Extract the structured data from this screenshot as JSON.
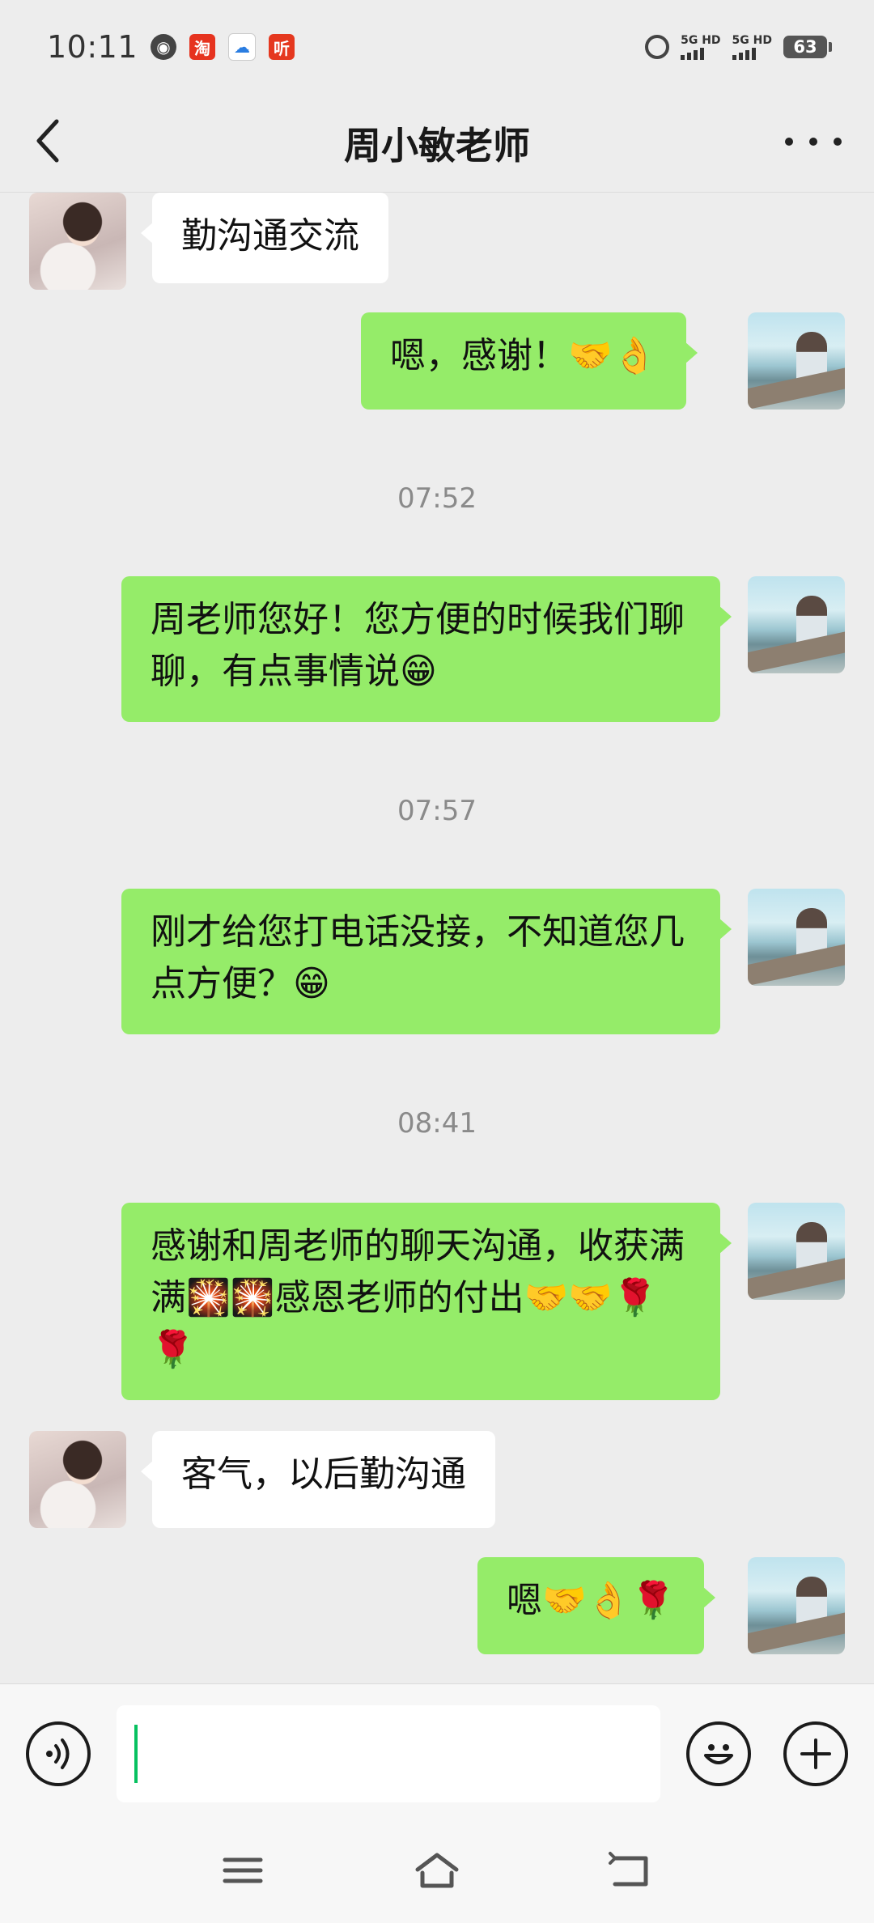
{
  "status_bar": {
    "time": "10:11",
    "network_1": "5G HD",
    "network_2": "5G HD",
    "battery": "63",
    "app_icons": [
      "globe-icon",
      "taobao-icon",
      "cloud-icon",
      "listen-icon"
    ]
  },
  "header": {
    "title": "周小敏老师",
    "back_icon": "chevron-left-icon",
    "more_icon": "more-dots-icon"
  },
  "messages": [
    {
      "side": "in",
      "text": "勤沟通交流"
    },
    {
      "side": "out",
      "text": "嗯，感谢！🤝👌"
    },
    {
      "type": "time",
      "text": "07:52"
    },
    {
      "side": "out",
      "text": "周老师您好！您方便的时候我们聊聊，有点事情说😁"
    },
    {
      "type": "time",
      "text": "07:57"
    },
    {
      "side": "out",
      "text": "刚才给您打电话没接，不知道您几点方便？😁"
    },
    {
      "type": "time",
      "text": "08:41"
    },
    {
      "side": "out",
      "text": "感谢和周老师的聊天沟通，收获满满🎇🎇感恩老师的付出🤝🤝🌹🌹"
    },
    {
      "side": "in",
      "text": "客气，以后勤沟通"
    },
    {
      "side": "out",
      "text": "嗯🤝👌🌹"
    }
  ],
  "input_bar": {
    "voice_icon": "voice-icon",
    "input_value": "",
    "emoji_icon": "emoji-icon",
    "plus_icon": "plus-icon"
  },
  "colors": {
    "background": "#ededed",
    "outgoing_bubble": "#95ec69",
    "incoming_bubble": "#ffffff",
    "cursor": "#07c160"
  }
}
